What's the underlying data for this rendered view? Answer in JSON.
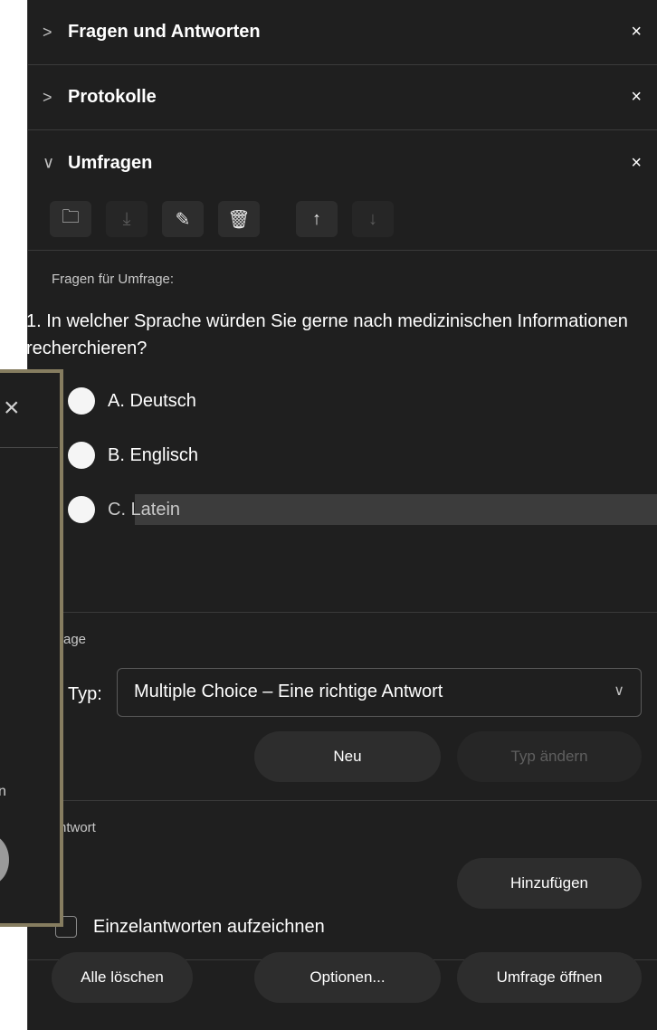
{
  "sections": [
    {
      "title": "Fragen und Antworten",
      "chevron": ">",
      "close": "×"
    },
    {
      "title": "Protokolle",
      "chevron": ">",
      "close": "×"
    },
    {
      "title": "Umfragen",
      "chevron": "∨",
      "close": "×"
    }
  ],
  "toolbar": {
    "icons": [
      "folder-icon",
      "save-icon",
      "edit-icon",
      "delete-icon",
      "arrow-up-icon",
      "arrow-down-icon"
    ],
    "glyphs": [
      "🗀",
      "⤓",
      "✎",
      "🗑",
      "↑",
      "↓"
    ]
  },
  "poll": {
    "questions_label": "Fragen für Umfrage:",
    "question": "1.  In welcher Sprache würden Sie gerne nach medizinischen Informationen recherchieren?",
    "answers": [
      "A.  Deutsch",
      "B.  Englisch",
      "C.  Latein"
    ]
  },
  "question_section": {
    "label": "rage",
    "type_label": "Typ:",
    "type_value": "Multiple Choice – Eine richtige Antwort",
    "new_button": "Neu",
    "change_type_button": "Typ ändern"
  },
  "answer_section": {
    "label": "ntwort",
    "add_button": "Hinzufügen",
    "checkbox_label": "Einzelantworten aufzeichnen"
  },
  "footer": {
    "clear_all": "Alle löschen",
    "options": "Optionen...",
    "open_poll": "Umfrage öffnen"
  },
  "dialog": {
    "close": "×",
    "fragment": "n"
  }
}
